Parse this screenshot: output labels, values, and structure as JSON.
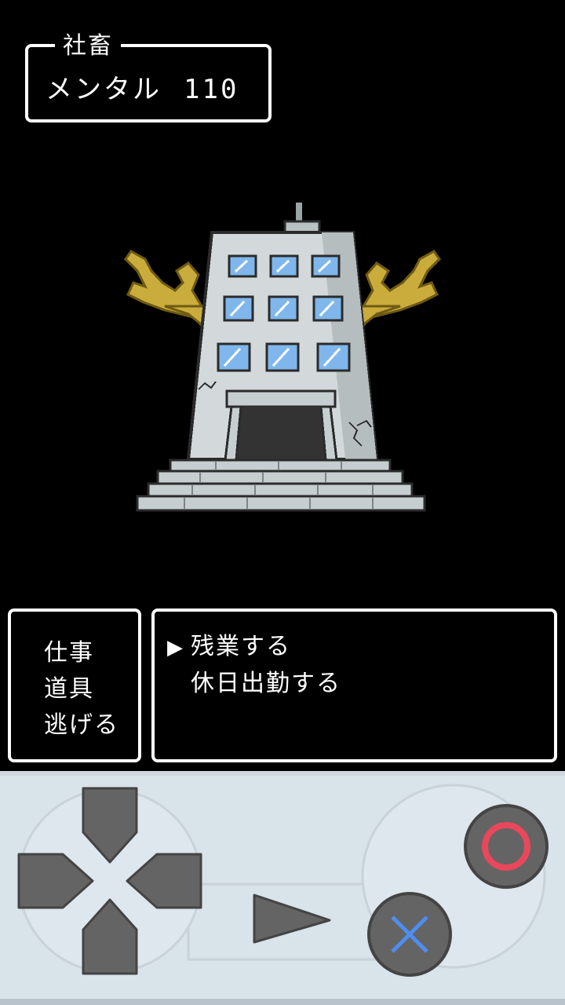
{
  "status": {
    "name": "社畜",
    "stat_label": "メンタル",
    "stat_value": "110"
  },
  "enemy": {
    "icon": "haunted-office-building"
  },
  "command_menu": {
    "items": [
      {
        "label": "仕事"
      },
      {
        "label": "道具"
      },
      {
        "label": "逃げる"
      }
    ]
  },
  "sub_menu": {
    "cursor": "▶",
    "selected_index": 0,
    "items": [
      {
        "label": "残業する"
      },
      {
        "label": "休日出勤する"
      }
    ]
  },
  "controller": {
    "dpad_icon": "dpad",
    "start_icon": "play-triangle",
    "confirm_icon": "circle-button",
    "cancel_icon": "cross-button",
    "colors": {
      "background": "#d9e3ea",
      "button": "#646464",
      "circle_mark": "#e8475c",
      "cross_mark": "#4d8ef0"
    }
  }
}
